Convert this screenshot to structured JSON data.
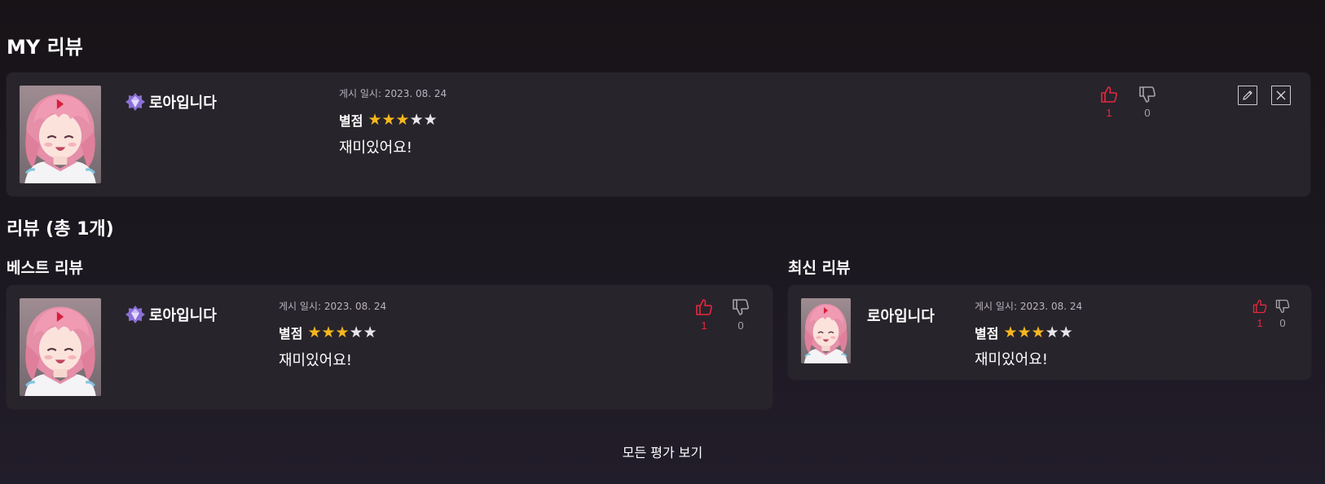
{
  "my_review_section": {
    "title": "MY 리뷰",
    "review": {
      "username": "로아입니다",
      "posted": "게시 일시: 2023. 08. 24",
      "rating_label": "별점",
      "rating": 3,
      "rating_max": 5,
      "content": "재미있어요!",
      "likes": "1",
      "dislikes": "0"
    }
  },
  "reviews_section": {
    "title": "리뷰 (총 1개)",
    "best": {
      "title": "베스트 리뷰",
      "review": {
        "username": "로아입니다",
        "posted": "게시 일시: 2023. 08. 24",
        "rating_label": "별점",
        "rating": 3,
        "rating_max": 5,
        "content": "재미있어요!",
        "likes": "1",
        "dislikes": "0"
      }
    },
    "latest": {
      "title": "최신 리뷰",
      "review": {
        "username": "로아입니다",
        "posted": "게시 일시: 2023. 08. 24",
        "rating_label": "별점",
        "rating": 3,
        "rating_max": 5,
        "content": "재미있어요!",
        "likes": "1",
        "dislikes": "0"
      }
    }
  },
  "view_all_label": "모든 평가 보기",
  "icons": {
    "like": "thumbs-up-icon",
    "dislike": "thumbs-down-icon",
    "edit": "pencil-icon",
    "delete": "close-icon",
    "badge": "gem-badge-icon"
  },
  "colors": {
    "accent_red": "#e8273f",
    "star_on": "#f6b71e",
    "star_off": "#e8e6ea",
    "card_bg": "#28242b"
  }
}
